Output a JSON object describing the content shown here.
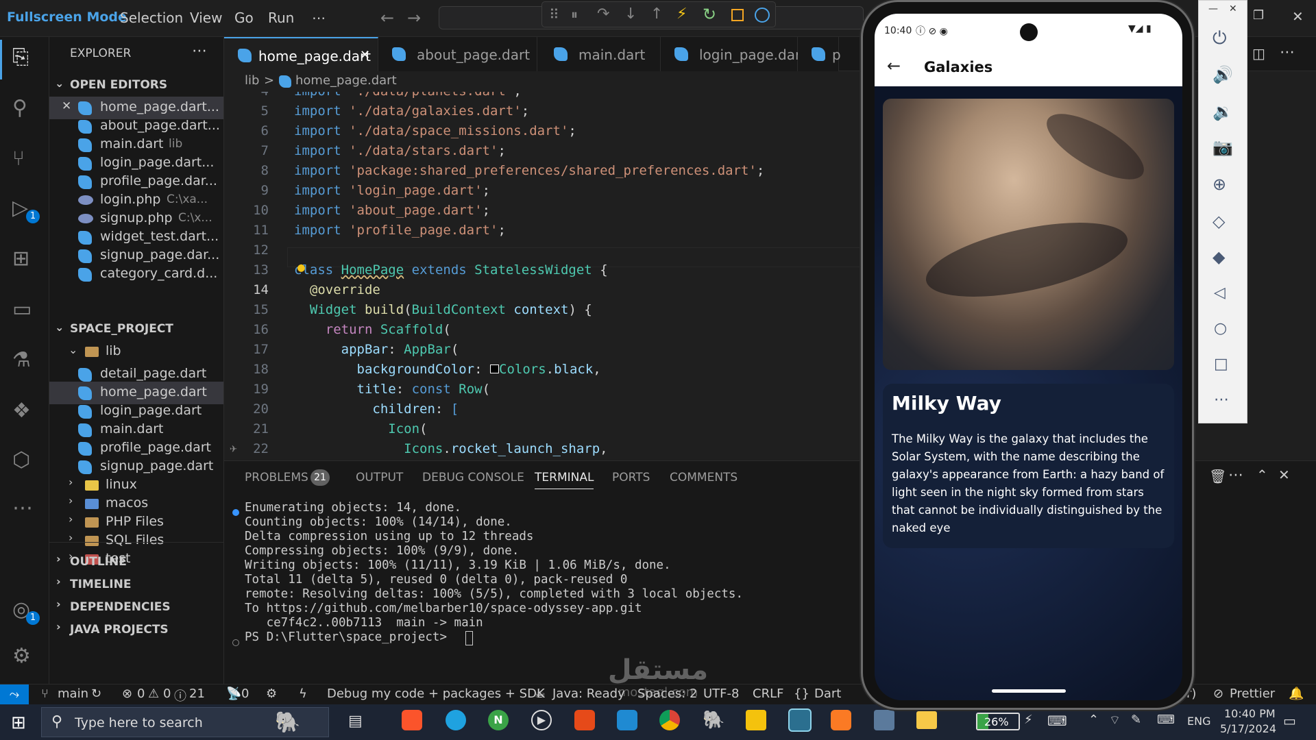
{
  "titlebar": {
    "menu": [
      "Fullscreen Mode",
      "Selection",
      "View",
      "Go",
      "Run",
      "⋯"
    ],
    "debug_icons": [
      "grip-icon",
      "pause-icon",
      "step-over-icon",
      "step-into-icon",
      "step-out-icon",
      "hot-reload-icon",
      "restart-icon",
      "stop-icon",
      "devtools-icon"
    ]
  },
  "activity": {
    "badges": {
      "debug": "1",
      "accounts": "1"
    }
  },
  "explorer": {
    "title": "EXPLORER",
    "more": "⋯",
    "open_editors_label": "OPEN EDITORS",
    "open_editors": [
      {
        "name": "home_page.dart...",
        "detail": "",
        "kind": "dart",
        "close": "✕"
      },
      {
        "name": "about_page.dart...",
        "detail": "",
        "kind": "dart"
      },
      {
        "name": "main.dart",
        "detail": "lib",
        "kind": "dart"
      },
      {
        "name": "login_page.dart...",
        "detail": "",
        "kind": "dart"
      },
      {
        "name": "profile_page.dar...",
        "detail": "",
        "kind": "dart"
      },
      {
        "name": "login.php",
        "detail": "C:\\xa...",
        "kind": "php"
      },
      {
        "name": "signup.php",
        "detail": "C:\\x...",
        "kind": "php"
      },
      {
        "name": "widget_test.dart...",
        "detail": "",
        "kind": "dart"
      },
      {
        "name": "signup_page.dar...",
        "detail": "",
        "kind": "dart"
      },
      {
        "name": "category_card.d...",
        "detail": "",
        "kind": "dart"
      }
    ],
    "project_label": "SPACE_PROJECT",
    "lib_folder": "lib",
    "lib_files": [
      "detail_page.dart",
      "home_page.dart",
      "login_page.dart",
      "main.dart",
      "profile_page.dart",
      "signup_page.dart"
    ],
    "folders": [
      "linux",
      "macos",
      "PHP Files",
      "SQL Files",
      "test"
    ],
    "sections": [
      "OUTLINE",
      "TIMELINE",
      "DEPENDENCIES",
      "JAVA PROJECTS"
    ]
  },
  "tabs": [
    "home_page.dart",
    "about_page.dart",
    "main.dart",
    "login_page.dart",
    "p"
  ],
  "tab_close": "✕",
  "breadcrumb": {
    "folder": "lib",
    "sep": ">",
    "file": "home_page.dart"
  },
  "code": {
    "numbers": [
      "4",
      "5",
      "6",
      "7",
      "8",
      "9",
      "10",
      "11",
      "12",
      "13",
      "14",
      "15",
      "16",
      "17",
      "18",
      "19",
      "20",
      "21",
      "22"
    ]
  },
  "panel": {
    "tabs": [
      "PROBLEMS",
      "OUTPUT",
      "DEBUG CONSOLE",
      "TERMINAL",
      "PORTS",
      "COMMENTS"
    ],
    "problems_count": "21",
    "terminal_lines": [
      "Enumerating objects: 14, done.",
      "Counting objects: 100% (14/14), done.",
      "Delta compression using up to 12 threads",
      "Compressing objects: 100% (9/9), done.",
      "Writing objects: 100% (11/11), 3.19 KiB | 1.06 MiB/s, done.",
      "Total 11 (delta 5), reused 0 (delta 0), pack-reused 0",
      "remote: Resolving deltas: 100% (5/5), completed with 3 local objects.",
      "To https://github.com/melbarber10/space-odyssey-app.git",
      "   ce7f4c2..00b7113  main -> main",
      "PS D:\\Flutter\\space_project> "
    ]
  },
  "status": {
    "remote": "⤳",
    "branch": "main",
    "errors": "0",
    "warnings": "0",
    "info": "21",
    "ports": "0",
    "debug_mode": "Debug my code + packages + SDK",
    "java": "Java: Ready",
    "spaces": "Spaces: 2",
    "encoding": "UTF-8",
    "eol": "CRLF",
    "language": "Dart",
    "device": "or)",
    "prettier": "Prettier"
  },
  "phone": {
    "time": "10:40",
    "appbar_title": "Galaxies",
    "card_title": "Milky Way",
    "card_text": "The Milky Way is the galaxy that includes the Solar System, with the name describing the galaxy's appearance from Earth: a hazy band of light seen in the night sky formed from stars that cannot be individually distinguished by the naked eye"
  },
  "taskbar": {
    "search_placeholder": "Type here to search",
    "battery": "26%",
    "lang": "ENG",
    "time": "10:40 PM",
    "date": "5/17/2024"
  },
  "watermark": {
    "brand": "مستقل",
    "site": "mostaql.com"
  }
}
